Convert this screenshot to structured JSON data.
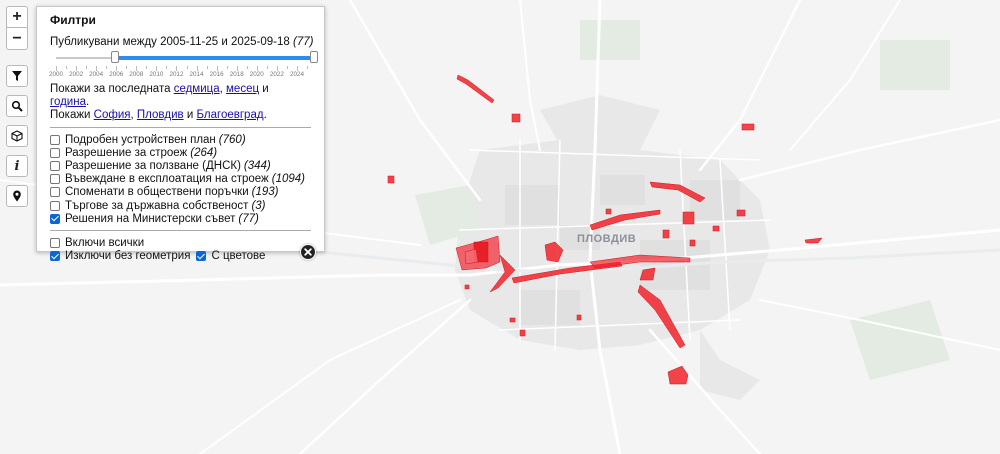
{
  "map": {
    "city_label": "ПЛОВДИВ",
    "colors": {
      "background": "#f2f3f2",
      "road": "#ffffff",
      "urban": "#e6e7e6",
      "highlight": "#f0242c"
    }
  },
  "toolbar": {
    "zoom_in": "+",
    "zoom_out": "−",
    "filter_icon": "filter-icon",
    "search_icon": "search-icon",
    "layers_icon": "cube-icon",
    "info_icon": "info-icon",
    "locate_icon": "map-pin-icon"
  },
  "filters": {
    "title": "Филтри",
    "range": {
      "prefix": "Публикувани между",
      "from": "2005-11-25",
      "conjunction": "и",
      "to": "2025-09-18",
      "count": "(77)",
      "min_year": 2000,
      "max_year": 2025,
      "from_year_value": 2005.9,
      "to_year_value": 2025.7,
      "tick_labels": [
        "2000",
        "2002",
        "2004",
        "2006",
        "2008",
        "2010",
        "2012",
        "2014",
        "2016",
        "2018",
        "2020",
        "2022",
        "2024"
      ]
    },
    "quick": {
      "line1_prefix": "Покажи за последната",
      "week": "седмица",
      "sep1": ",",
      "month": "месец",
      "and1": "и",
      "year": "година",
      "end1": ".",
      "line2_prefix": "Покажи",
      "sofia": "София",
      "sep2": ",",
      "plovdiv": "Пловдив",
      "and2": "и",
      "blagoevgrad": "Благоевград",
      "end2": "."
    },
    "categories": [
      {
        "label": "Подробен устройствен план",
        "count": "(760)",
        "checked": false
      },
      {
        "label": "Разрешение за строеж",
        "count": "(264)",
        "checked": false
      },
      {
        "label": "Разрешение за ползване (ДНСК)",
        "count": "(344)",
        "checked": false
      },
      {
        "label": "Въвеждане в експлоатация на строеж",
        "count": "(1094)",
        "checked": false
      },
      {
        "label": "Споменати в обществени поръчки",
        "count": "(193)",
        "checked": false
      },
      {
        "label": "Търгове за държавна собственост",
        "count": "(3)",
        "checked": false
      },
      {
        "label": "Решения на Министерски съвет",
        "count": "(77)",
        "checked": true
      }
    ],
    "options": {
      "include_all": {
        "label": "Включи всички",
        "checked": false
      },
      "exclude_no_geometry": {
        "label": "Изключи без геометрия",
        "checked": true
      },
      "with_colors": {
        "label": "С цветове",
        "checked": true
      }
    }
  }
}
